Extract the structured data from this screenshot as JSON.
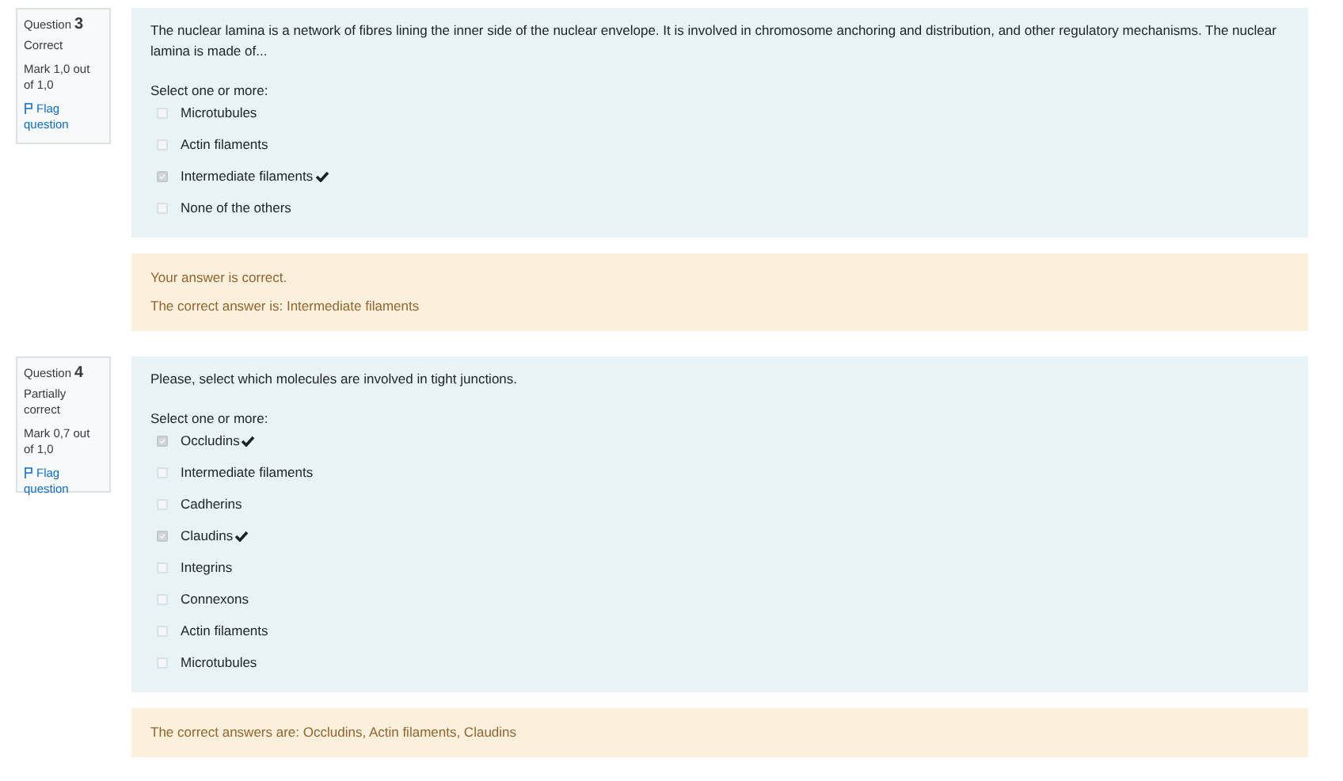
{
  "questions": [
    {
      "label": "Question",
      "number": "3",
      "state": "Correct",
      "mark": "Mark 1,0 out of 1,0",
      "flag": "Flag question",
      "text": "The nuclear lamina is a network of fibres lining the inner side of the nuclear envelope. It is involved in chromosome anchoring and distribution, and other regulatory mechanisms. The nuclear lamina is made of...",
      "prompt": "Select one or more:",
      "options": [
        {
          "label": "Microtubules",
          "checked": false,
          "tick": false
        },
        {
          "label": "Actin filaments",
          "checked": false,
          "tick": false
        },
        {
          "label": "Intermediate filaments",
          "checked": true,
          "tick": true
        },
        {
          "label": "None of the others",
          "checked": false,
          "tick": false
        }
      ],
      "feedback": [
        "Your answer is correct.",
        "The correct answer is: Intermediate filaments"
      ]
    },
    {
      "label": "Question",
      "number": "4",
      "state": "Partially correct",
      "mark": "Mark 0,7 out of 1,0",
      "flag": "Flag question",
      "text": "Please, select which molecules are involved in tight junctions.",
      "prompt": "Select one or more:",
      "options": [
        {
          "label": "Occludins",
          "checked": true,
          "tick": true
        },
        {
          "label": "Intermediate filaments",
          "checked": false,
          "tick": false
        },
        {
          "label": "Cadherins",
          "checked": false,
          "tick": false
        },
        {
          "label": "Claudins",
          "checked": true,
          "tick": true
        },
        {
          "label": "Integrins",
          "checked": false,
          "tick": false
        },
        {
          "label": "Connexons",
          "checked": false,
          "tick": false
        },
        {
          "label": "Actin filaments",
          "checked": false,
          "tick": false
        },
        {
          "label": "Microtubules",
          "checked": false,
          "tick": false
        }
      ],
      "feedback": [
        "The correct answers are: Occludins, Actin filaments, Claudins"
      ]
    }
  ]
}
